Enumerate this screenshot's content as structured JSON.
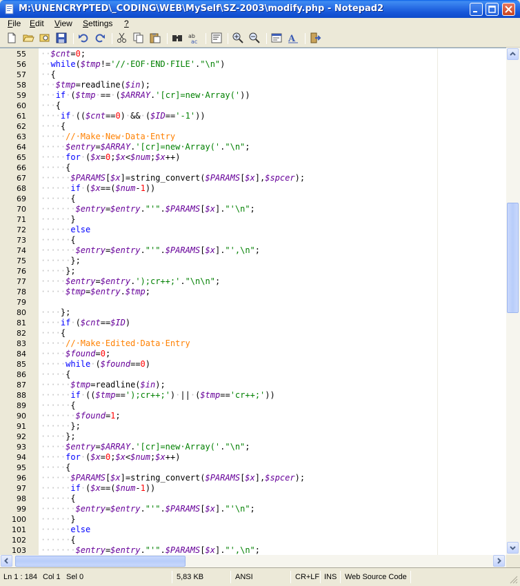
{
  "window": {
    "title": "M:\\UNENCRYPTED\\_CODING\\WEB\\MySelf\\SZ-2003\\modify.php - Notepad2"
  },
  "menu": [
    {
      "label": "File",
      "hotkey": "F"
    },
    {
      "label": "Edit",
      "hotkey": "E"
    },
    {
      "label": "View",
      "hotkey": "V"
    },
    {
      "label": "Settings",
      "hotkey": "S"
    },
    {
      "label": "?",
      "hotkey": "?"
    }
  ],
  "toolbar": {
    "icons": [
      "new-file-icon",
      "open-folder-icon",
      "browse-icon",
      "save-icon",
      "undo-icon",
      "redo-icon",
      "cut-icon",
      "copy-icon",
      "paste-icon",
      "find-icon",
      "replace-icon",
      "word-wrap-icon",
      "zoom-in-icon",
      "zoom-out-icon",
      "scheme-icon",
      "font-icon",
      "exit-icon"
    ]
  },
  "colors": {
    "keyword": "#0000FF",
    "variable": "#660099",
    "number": "#FF0000",
    "string": "#008000",
    "comment": "#FF8000",
    "whitespace": "#C0C0C0"
  },
  "editor": {
    "lines": [
      {
        "n": "55",
        "code": "··$cnt=0;"
      },
      {
        "n": "56",
        "code": "··while($tmp!='//·EOF·END·FILE'.\"\\n\")"
      },
      {
        "n": "57",
        "code": "··{"
      },
      {
        "n": "58",
        "code": "···$tmp=readline($in);"
      },
      {
        "n": "59",
        "code": "···if·($tmp·==·($ARRAY.'[cr]=new·Array('))"
      },
      {
        "n": "60",
        "code": "···{"
      },
      {
        "n": "61",
        "code": "····if·(($cnt==0)·&&·($ID=='-1'))"
      },
      {
        "n": "62",
        "code": "····{"
      },
      {
        "n": "63",
        "code": "·····//·Make·New·Data·Entry"
      },
      {
        "n": "64",
        "code": "·····$entry=$ARRAY.'[cr]=new·Array('.\"\\n\";"
      },
      {
        "n": "65",
        "code": "·····for·($x=0;$x<$num;$x++)"
      },
      {
        "n": "66",
        "code": "·····{"
      },
      {
        "n": "67",
        "code": "······$PARAMS[$x]=string_convert($PARAMS[$x],$spcer);"
      },
      {
        "n": "68",
        "code": "······if·($x==($num-1))"
      },
      {
        "n": "69",
        "code": "······{"
      },
      {
        "n": "70",
        "code": "·······$entry=$entry.\"'\".$PARAMS[$x].\"'\\n\";"
      },
      {
        "n": "71",
        "code": "······}"
      },
      {
        "n": "72",
        "code": "······else"
      },
      {
        "n": "73",
        "code": "······{"
      },
      {
        "n": "74",
        "code": "·······$entry=$entry.\"'\".$PARAMS[$x].\"',\\n\";"
      },
      {
        "n": "75",
        "code": "······};"
      },
      {
        "n": "76",
        "code": "·····};"
      },
      {
        "n": "77",
        "code": "·····$entry=$entry.');cr++;'.\"\\n\\n\";"
      },
      {
        "n": "78",
        "code": "·····$tmp=$entry.$tmp;"
      },
      {
        "n": "79",
        "code": ""
      },
      {
        "n": "80",
        "code": "····};"
      },
      {
        "n": "81",
        "code": "····if·($cnt==$ID)"
      },
      {
        "n": "82",
        "code": "····{"
      },
      {
        "n": "83",
        "code": "·····//·Make·Edited·Data·Entry"
      },
      {
        "n": "84",
        "code": "·····$found=0;"
      },
      {
        "n": "85",
        "code": "·····while·($found==0)"
      },
      {
        "n": "86",
        "code": "·····{"
      },
      {
        "n": "87",
        "code": "······$tmp=readline($in);"
      },
      {
        "n": "88",
        "code": "······if·(($tmp==');cr++;')·||·($tmp=='cr++;'))"
      },
      {
        "n": "89",
        "code": "······{"
      },
      {
        "n": "90",
        "code": "·······$found=1;"
      },
      {
        "n": "91",
        "code": "······};"
      },
      {
        "n": "92",
        "code": "·····};"
      },
      {
        "n": "93",
        "code": "·····$entry=$ARRAY.'[cr]=new·Array('.\"\\n\";"
      },
      {
        "n": "94",
        "code": "·····for·($x=0;$x<$num;$x++)"
      },
      {
        "n": "95",
        "code": "·····{"
      },
      {
        "n": "96",
        "code": "······$PARAMS[$x]=string_convert($PARAMS[$x],$spcer);"
      },
      {
        "n": "97",
        "code": "······if·($x==($num-1))"
      },
      {
        "n": "98",
        "code": "······{"
      },
      {
        "n": "99",
        "code": "·······$entry=$entry.\"'\".$PARAMS[$x].\"'\\n\";"
      },
      {
        "n": "100",
        "code": "······}"
      },
      {
        "n": "101",
        "code": "······else"
      },
      {
        "n": "102",
        "code": "······{"
      },
      {
        "n": "103",
        "code": "·······$entry=$entry.\"'\".$PARAMS[$x].\"',\\n\";"
      }
    ]
  },
  "status": {
    "position": "Ln 1 : 184",
    "column": "Col 1",
    "selection": "Sel 0",
    "size": "5,83 KB",
    "encoding": "ANSI",
    "line_endings": "CR+LF",
    "insert_mode": "INS",
    "scheme": "Web Source Code"
  }
}
